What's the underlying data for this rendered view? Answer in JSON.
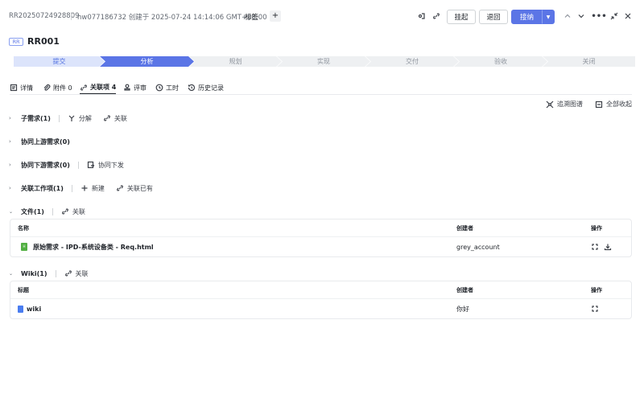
{
  "header": {
    "id": "RR20250724928809",
    "creator_info": "hw077186732 创建于 2025-07-24 14:14:06 GMT+08:00",
    "tag_label": "标签",
    "add_tag_symbol": "+",
    "suspend_label": "挂起",
    "return_label": "退回",
    "accept_label": "接纳"
  },
  "title": {
    "badge": "RR",
    "name": "RR001"
  },
  "steps": [
    {
      "label": "提交",
      "state": "done"
    },
    {
      "label": "分析",
      "state": "active"
    },
    {
      "label": "规划",
      "state": "todo"
    },
    {
      "label": "实现",
      "state": "todo"
    },
    {
      "label": "交付",
      "state": "todo"
    },
    {
      "label": "验收",
      "state": "todo"
    },
    {
      "label": "关闭",
      "state": "todo"
    }
  ],
  "tabs": [
    {
      "label": "详情"
    },
    {
      "label": "附件 0"
    },
    {
      "label": "关联项 4"
    },
    {
      "label": "评审"
    },
    {
      "label": "工时"
    },
    {
      "label": "历史记录"
    }
  ],
  "toolbar": {
    "trace_label": "追溯图谱",
    "collapse_all_label": "全部收起"
  },
  "sections": {
    "child": {
      "title": "子需求(1)",
      "action1": "分解",
      "action2": "关联"
    },
    "upstream": {
      "title": "协同上游需求(0)"
    },
    "downstream": {
      "title": "协同下游需求(0)",
      "action1": "协同下发"
    },
    "workitems": {
      "title": "关联工作项(1)",
      "action1": "新建",
      "action2": "关联已有"
    },
    "files": {
      "title": "文件(1)",
      "action1": "关联",
      "columns": {
        "name": "名称",
        "creator": "创建者",
        "ops": "操作"
      },
      "rows": [
        {
          "name": "原始需求 - IPD-系统设备类 - Req.html",
          "creator": "grey_account"
        }
      ]
    },
    "wiki": {
      "title": "Wiki(1)",
      "action1": "关联",
      "columns": {
        "name": "标题",
        "creator": "创建者",
        "ops": "操作"
      },
      "rows": [
        {
          "name": "wiki",
          "creator": "你好"
        }
      ]
    }
  },
  "colors": {
    "primary": "#5b75e6",
    "step_done_bg": "#dce4fb",
    "step_todo_bg": "#eef0f2",
    "file_icon": "#52b043",
    "wiki_icon": "#4a7df0"
  }
}
